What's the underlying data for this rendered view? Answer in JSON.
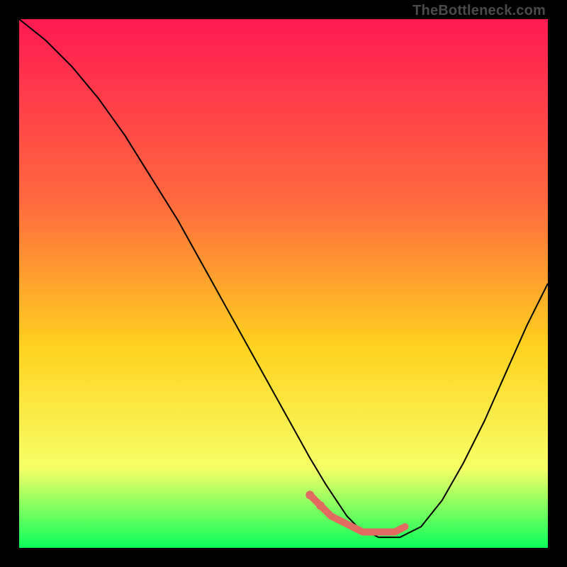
{
  "attribution": "TheBottleneck.com",
  "colors": {
    "gradient_top": "#ff1a52",
    "gradient_mid1": "#ff6b3d",
    "gradient_mid2": "#ffd21f",
    "gradient_mid3": "#f6ff66",
    "gradient_bottom": "#0aff5a",
    "curve": "#000000",
    "marker": "#e16a61",
    "background": "#000000"
  },
  "chart_data": {
    "type": "line",
    "title": "",
    "xlabel": "",
    "ylabel": "",
    "xlim": [
      0,
      100
    ],
    "ylim": [
      0,
      100
    ],
    "series": [
      {
        "name": "bottleneck-curve",
        "x": [
          0,
          5,
          10,
          15,
          20,
          25,
          30,
          35,
          40,
          45,
          50,
          55,
          58,
          60,
          62,
          64,
          66,
          68,
          70,
          72,
          76,
          80,
          84,
          88,
          92,
          96,
          100
        ],
        "y": [
          100,
          96,
          91,
          85,
          78,
          70,
          62,
          53,
          44,
          35,
          26,
          17,
          12,
          9,
          6,
          4,
          3,
          2,
          2,
          2,
          4,
          9,
          16,
          24,
          33,
          42,
          50
        ]
      }
    ],
    "markers": {
      "name": "optimum-range",
      "x": [
        55,
        57,
        59,
        61,
        63,
        65,
        67,
        69,
        71,
        73
      ],
      "y": [
        10,
        8,
        6,
        5,
        4,
        3,
        3,
        3,
        3,
        4
      ]
    }
  }
}
